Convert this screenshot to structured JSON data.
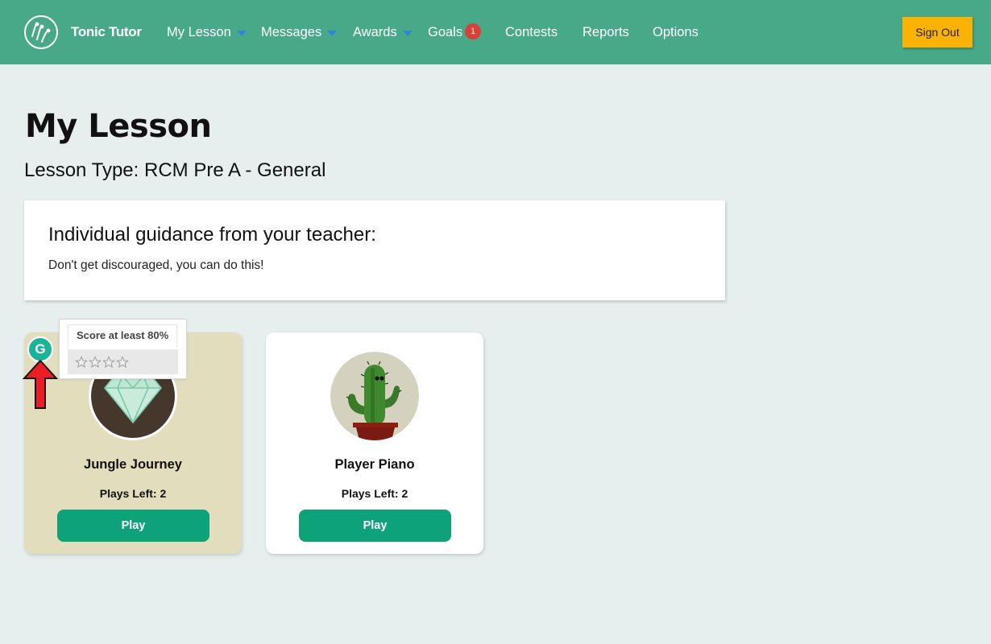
{
  "app": {
    "brand": "Tonic Tutor"
  },
  "nav": {
    "items": [
      {
        "label": "My Lesson",
        "dropdown": true
      },
      {
        "label": "Messages",
        "dropdown": true
      },
      {
        "label": "Awards",
        "dropdown": true
      },
      {
        "label": "Goals",
        "badge": "1"
      },
      {
        "label": "Contests"
      },
      {
        "label": "Reports"
      },
      {
        "label": "Options"
      }
    ],
    "sign_out_label": "Sign Out"
  },
  "page": {
    "title": "My Lesson",
    "lesson_type": "Lesson Type: RCM Pre A - General"
  },
  "guidance": {
    "title": "Individual guidance from your teacher:",
    "text": "Don't get discouraged, you can do this!"
  },
  "cards": [
    {
      "name": "Jungle Journey",
      "plays_left": "Plays Left: 2",
      "play_label": "Play",
      "icon": "diamond-icon",
      "badge_letter": "G"
    },
    {
      "name": "Player Piano",
      "plays_left": "Plays Left: 2",
      "play_label": "Play",
      "icon": "cactus-icon"
    }
  ],
  "tooltip": {
    "title": "Score at least 80%",
    "stars_earned": 0,
    "stars_total": 4
  },
  "colors": {
    "navbar": "#48a988",
    "accent_button": "#fbb202",
    "play_button": "#0da278",
    "badge": "#d8403a",
    "page_background": "#e6efee"
  }
}
